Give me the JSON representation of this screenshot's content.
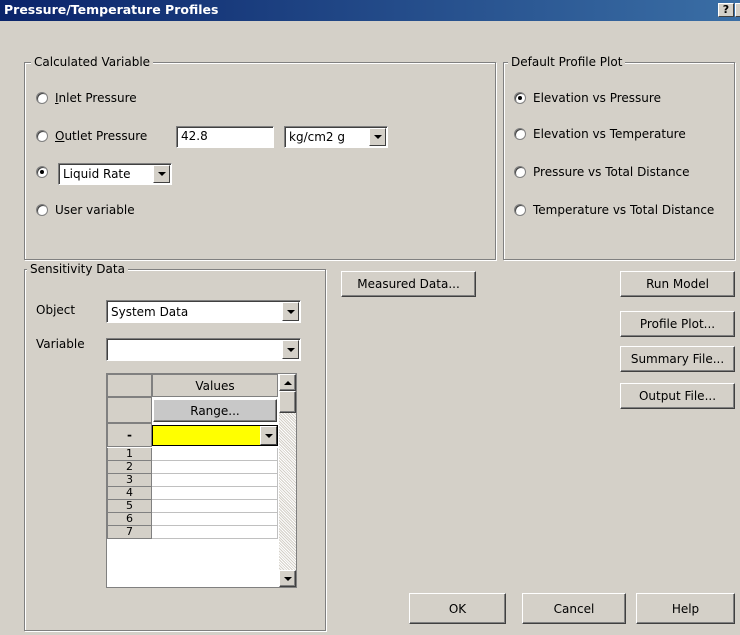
{
  "window": {
    "title": "Pressure/Temperature Profiles",
    "help_glyph": "?",
    "close_glyph": "×"
  },
  "calculated_variable": {
    "legend": "Calculated Variable",
    "inlet_pressure": {
      "label_first": "I",
      "label_rest": "nlet Pressure",
      "selected": false
    },
    "outlet_pressure": {
      "label_first": "O",
      "label_rest": "utlet Pressure",
      "selected": false,
      "value": "42.8",
      "unit": "kg/cm2 g"
    },
    "liquid_rate": {
      "value": "Liquid Rate",
      "selected": true
    },
    "user_variable": {
      "label": "User variable",
      "selected": false
    }
  },
  "default_profile_plot": {
    "legend": "Default Profile Plot",
    "options": [
      {
        "label": "Elevation vs Pressure",
        "selected": true
      },
      {
        "label": "Elevation vs Temperature",
        "selected": false
      },
      {
        "label": "Pressure vs Total Distance",
        "selected": false
      },
      {
        "label": "Temperature vs Total Distance",
        "selected": false
      }
    ]
  },
  "sensitivity": {
    "legend": "Sensitivity Data",
    "object_label": "Object",
    "object_value": "System Data",
    "variable_label": "Variable",
    "variable_value": "",
    "grid": {
      "header": "Values",
      "range_button": "Range...",
      "dash_row": "-",
      "row_numbers": [
        "1",
        "2",
        "3",
        "4",
        "5",
        "6",
        "7"
      ],
      "highlight_color": "#ffff00"
    }
  },
  "buttons": {
    "measured_data": "Measured Data...",
    "run_model": "Run Model",
    "profile_plot": "Profile Plot...",
    "summary_file": "Summary File...",
    "output_file": "Output File...",
    "ok": "OK",
    "cancel": "Cancel",
    "help": "Help"
  }
}
